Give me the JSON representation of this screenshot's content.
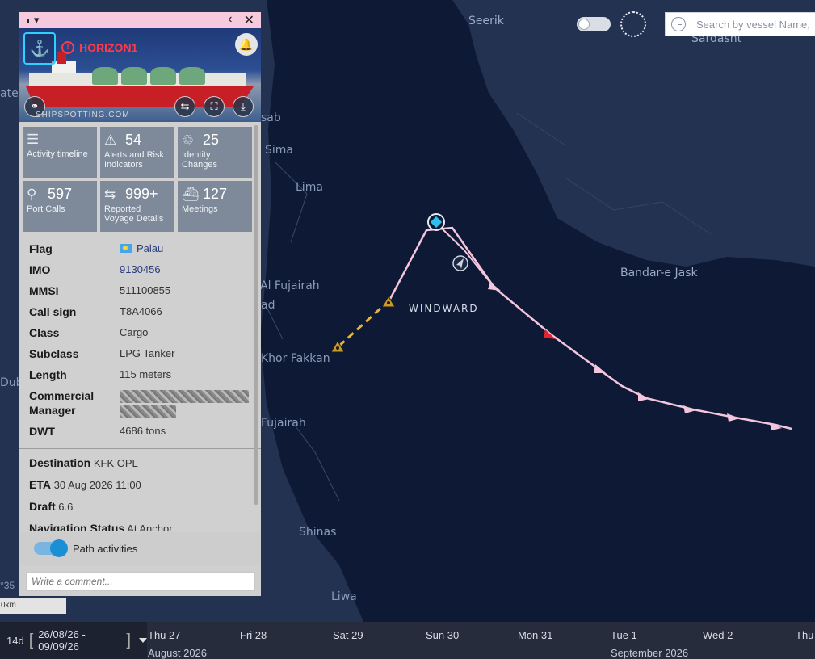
{
  "map": {
    "places": [
      {
        "name": "Seerik",
        "cls": "big"
      },
      {
        "name": "Sardasht",
        "cls": "big"
      },
      {
        "name": "Bandar-e Jask",
        "cls": "big"
      },
      {
        "name": "Sima",
        "cls": ""
      },
      {
        "name": "Lima",
        "cls": ""
      },
      {
        "name": "Al Fujairah",
        "cls": ""
      },
      {
        "name": "Khor Fakkan",
        "cls": ""
      },
      {
        "name": "Fujairah",
        "cls": ""
      },
      {
        "name": "Shinas",
        "cls": ""
      },
      {
        "name": "Liwa",
        "cls": ""
      },
      {
        "name": "sab",
        "cls": ""
      },
      {
        "name": "ad",
        "cls": ""
      },
      {
        "name": "Dub",
        "cls": ""
      },
      {
        "name": "ate",
        "cls": ""
      }
    ],
    "brand": "WINDWARD",
    "coord_text": "°35",
    "scale_label": "0km"
  },
  "top_controls": {
    "search_placeholder": "Search by vessel Name, IMO..."
  },
  "panel": {
    "top_icon": "◐",
    "top_caret": "▾",
    "back_glyph": "‹",
    "close_glyph": "✕",
    "vessel_name": "HORIZON1",
    "alert_glyph": "!",
    "photo_credit": "SHIPSPOTTING.COM",
    "tiles": [
      {
        "icon": "☰",
        "number": "",
        "label": "Activity timeline"
      },
      {
        "icon": "⚠",
        "number": "54",
        "label": "Alerts and Risk Indicators"
      },
      {
        "icon": "♲",
        "number": "25",
        "label": "Identity Changes"
      },
      {
        "icon": "⚲",
        "number": "597",
        "label": "Port Calls"
      },
      {
        "icon": "⇆",
        "number": "999+",
        "label": "Reported Voyage Details"
      },
      {
        "icon": "⛴",
        "number": "127",
        "label": "Meetings"
      }
    ],
    "details": [
      {
        "key": "Flag",
        "value": "Palau"
      },
      {
        "key": "IMO",
        "value": "9130456"
      },
      {
        "key": "MMSI",
        "value": "511100855"
      },
      {
        "key": "Call sign",
        "value": "T8A4066"
      },
      {
        "key": "Class",
        "value": "Cargo"
      },
      {
        "key": "Subclass",
        "value": "LPG Tanker"
      },
      {
        "key": "Length",
        "value": "115 meters"
      },
      {
        "key": "Commercial Manager",
        "value": ""
      },
      {
        "key": "DWT",
        "value": "4686 tons"
      }
    ],
    "voyage": [
      {
        "key": "Destination",
        "value": "KFK OPL"
      },
      {
        "key": "ETA",
        "value": "30 Aug 2026 11:00"
      },
      {
        "key": "Draft",
        "value": "6.6"
      },
      {
        "key": "Navigation Status",
        "value": "At Anchor"
      }
    ],
    "path_activities_label": "Path activities",
    "path_activities_on": true,
    "comment_placeholder": "Write a comment..."
  },
  "timeline": {
    "span": "14d",
    "range": "26/08/26 - 09/09/26",
    "days": [
      "Thu 27",
      "Fri 28",
      "Sat 29",
      "Sun 30",
      "Mon 31",
      "Tue 1",
      "Wed 2",
      "Thu"
    ],
    "months": [
      "August 2026",
      "September 2026"
    ]
  },
  "colors": {
    "track": "#f4c6dd",
    "dashed_track": "#e2b53a",
    "alert_red": "#ff3b4a",
    "accent_blue": "#1a8fd6"
  }
}
